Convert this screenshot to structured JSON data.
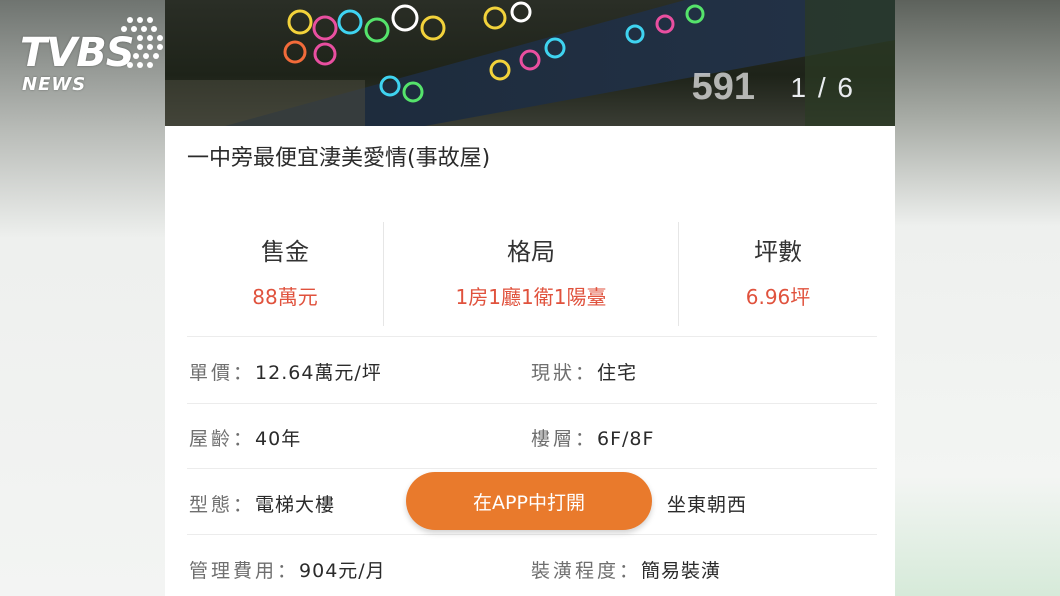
{
  "watermark": {
    "logo_main": "TVBS",
    "logo_sub": "NEWS"
  },
  "photo": {
    "brand_mark": "591",
    "counter": "1 / 6"
  },
  "listing": {
    "title": "一中旁最便宜淒美愛情(事故屋)"
  },
  "stats": [
    {
      "label": "售金",
      "value": "88萬元"
    },
    {
      "label": "格局",
      "value": "1房1廳1衛1陽臺"
    },
    {
      "label": "坪數",
      "value": "6.96坪"
    }
  ],
  "details": {
    "unit_price": {
      "label": "單價：",
      "value": "12.64萬元/坪"
    },
    "status": {
      "label": "現狀：",
      "value": "住宅"
    },
    "age": {
      "label": "屋齡：",
      "value": "40年"
    },
    "floor": {
      "label": "樓層：",
      "value": "6F/8F"
    },
    "type": {
      "label": "型態：",
      "value": "電梯大樓"
    },
    "orientation": {
      "value": "坐東朝西"
    },
    "management_fee": {
      "label": "管理費用：",
      "value": "904元/月"
    },
    "decoration": {
      "label": "裝潢程度：",
      "value": "簡易裝潢"
    }
  },
  "actions": {
    "open_in_app": "在APP中打開"
  },
  "colors": {
    "accent_orange": "#e97a2c",
    "price_red": "#e0523d"
  }
}
